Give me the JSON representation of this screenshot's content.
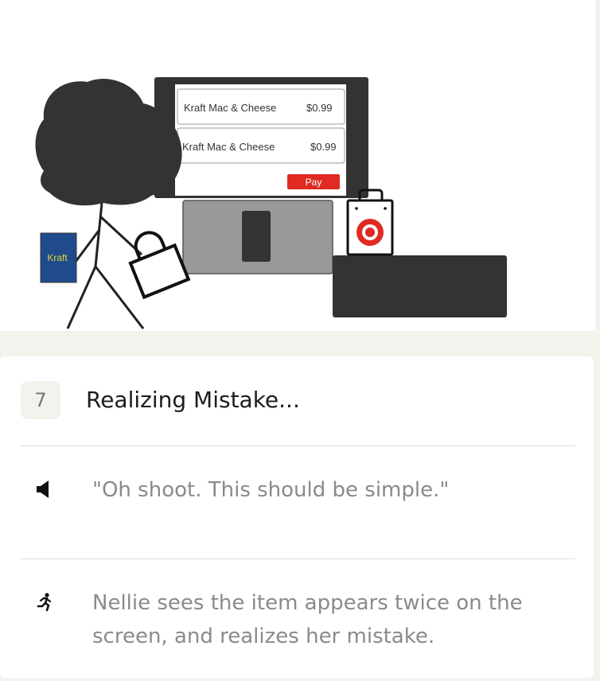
{
  "illustration": {
    "receipt_items": [
      {
        "name": "Kraft Mac & Cheese",
        "price": "$0.99"
      },
      {
        "name": "Kraft Mac & Cheese",
        "price": "$0.99"
      }
    ],
    "pay_label": "Pay",
    "box_label": "Kraft",
    "colors": {
      "pay": "#e02a22",
      "box": "#1f4b8c",
      "box_text": "#e3d23a",
      "target": "#e02a22",
      "dark": "#333333"
    }
  },
  "step": {
    "number": "7",
    "title": "Realizing Mistake..."
  },
  "rows": [
    {
      "icon": "speaker-icon",
      "text": "\"Oh shoot. This should be simple.\""
    },
    {
      "icon": "running-person-icon",
      "text": "Nellie sees the item appears twice on the screen, and realizes her mistake."
    }
  ]
}
